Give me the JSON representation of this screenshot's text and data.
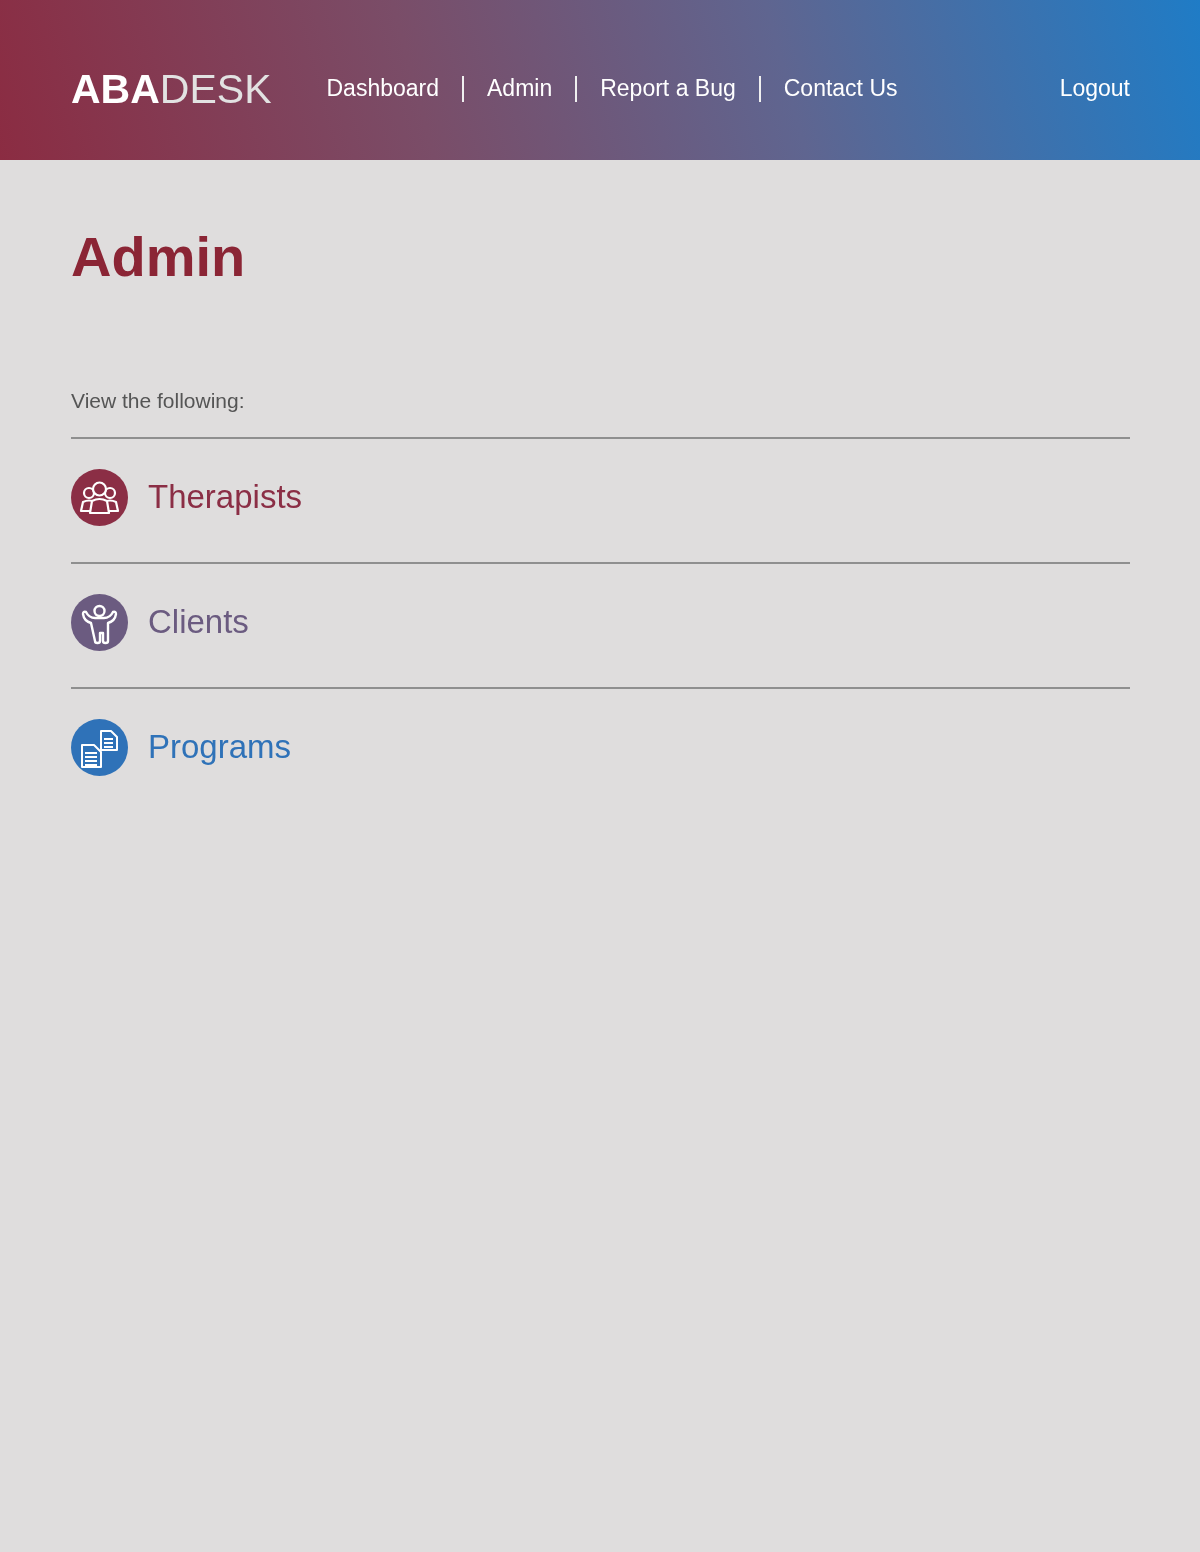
{
  "header": {
    "logo": "**ABA**DESK",
    "nav": [
      {
        "label": "Dashboard"
      },
      {
        "label": "Admin"
      },
      {
        "label": "Report a Bug"
      },
      {
        "label": "Contact Us"
      }
    ],
    "logout": "Logout"
  },
  "page": {
    "title": "Admin",
    "intro": "View the following:"
  },
  "items": [
    {
      "label": "Therapists",
      "kind": "group",
      "color": "#8b2e45"
    },
    {
      "label": "Clients",
      "kind": "person",
      "color": "#6b5b80"
    },
    {
      "label": "Programs",
      "kind": "documents",
      "color": "#2f72b8"
    }
  ]
}
